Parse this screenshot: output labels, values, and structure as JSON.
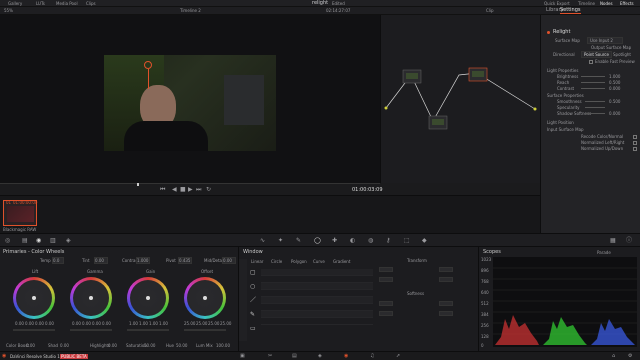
{
  "topbar": {
    "left_items": [
      "Gallery",
      "LUTs",
      "Media Pool",
      "Clips"
    ],
    "project_title": "relight",
    "project_status": "Edited",
    "right_items": [
      "Quick Export",
      "Timeline",
      "Nodes",
      "Effects"
    ]
  },
  "viewer": {
    "zoom": "55%",
    "timeline_name": "Timeline 2",
    "source_tc": "02:14:27:07",
    "mode": "Clip",
    "timecode": "01:00:03:09"
  },
  "inspector": {
    "tabs": [
      "Library",
      "Settings"
    ],
    "effect_title": "Relight",
    "surface_map_label": "Surface Map",
    "surface_map_value": "Use Input 2",
    "output_label": "Output Surface Map",
    "light_types": [
      "Directional",
      "Point Source",
      "Spotlight"
    ],
    "enable_preview": "Enable Fast Preview",
    "light_properties": "Light Properties",
    "brightness_label": "Brightness",
    "brightness_value": "1.000",
    "reach_label": "Reach",
    "reach_value": "0.500",
    "contrast_label": "Contrast",
    "contrast_value": "0.000",
    "surface_properties": "Surface Properties",
    "smoothness_label": "Smoothness",
    "smoothness_value": "0.500",
    "specularity_label": "Specularity",
    "specularity_value": "",
    "shadow_label": "Shadow Softness",
    "shadow_value": "0.000",
    "light_position": "Light Position",
    "input_surface_map": "Input Surface Map",
    "recode_label": "Recode Color/Normal",
    "normalized_left": "Normalized Left/Right",
    "normalized_up": "Normalized Up/Down"
  },
  "clip": {
    "number": "01",
    "tc": "01:00:00:00",
    "codec": "Blackmagic RAW"
  },
  "primaries": {
    "title": "Primaries - Color Wheels",
    "temp_label": "Temp",
    "temp_value": "0.0",
    "tint_label": "Tint",
    "tint_value": "0.00",
    "contrast_label": "Contrast",
    "contrast_value": "1.000",
    "pivot_label": "Pivot",
    "pivot_value": "0.435",
    "middetail_label": "Mid/Detail",
    "middetail_value": "0.00",
    "wheels": [
      {
        "name": "Lift",
        "values": [
          "0.00",
          "0.00",
          "0.00",
          "0.00"
        ]
      },
      {
        "name": "Gamma",
        "values": [
          "0.00",
          "0.00",
          "0.00",
          "0.00"
        ]
      },
      {
        "name": "Gain",
        "values": [
          "1.00",
          "1.00",
          "1.00",
          "1.00"
        ]
      },
      {
        "name": "Offset",
        "values": [
          "25.00",
          "25.00",
          "25.00",
          "25.00"
        ]
      }
    ],
    "footer": [
      {
        "label": "Color Boost",
        "value": "0.00"
      },
      {
        "label": "Shad",
        "value": "0.00"
      },
      {
        "label": "Highlights",
        "value": "0.00"
      },
      {
        "label": "Saturation",
        "value": "50.00"
      },
      {
        "label": "Hue",
        "value": "50.00"
      },
      {
        "label": "Lum Mix",
        "value": "100.00"
      }
    ]
  },
  "window_panel": {
    "title": "Window",
    "shapes": [
      "Linear",
      "Circle",
      "Polygon",
      "Curve",
      "Gradient"
    ],
    "transform_label": "Transform",
    "softness_label": "Softness"
  },
  "scopes": {
    "title": "Scopes",
    "mode": "Parade",
    "scale": [
      "1023",
      "896",
      "768",
      "640",
      "512",
      "384",
      "256",
      "128",
      "0"
    ]
  },
  "statusbar": {
    "app_name": "DaVinci Resolve Studio 19.0",
    "badge": "PUBLIC BETA"
  },
  "colors": {
    "accent": "#e0512b",
    "node_line": "#d8d8d8",
    "badge_bg": "#c8383c"
  }
}
